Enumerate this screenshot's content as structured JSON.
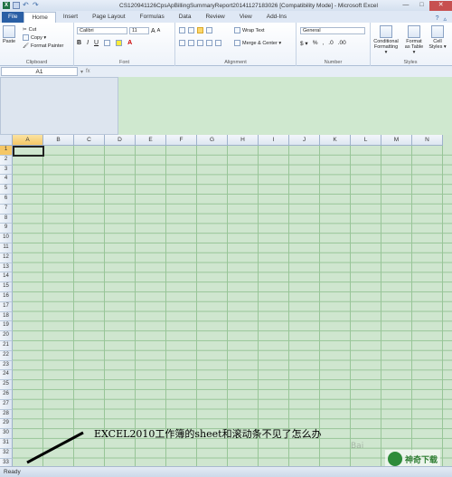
{
  "title_bar": {
    "title": "CS120941126CpsApBillingSummaryReport20141127183026  [Compatibility Mode]  -  Microsoft Excel",
    "minimize": "—",
    "maximize": "□",
    "close": "✕"
  },
  "tabs": [
    "File",
    "Home",
    "Insert",
    "Page Layout",
    "Formulas",
    "Data",
    "Review",
    "View",
    "Add-Ins"
  ],
  "ribbon": {
    "clipboard": {
      "paste": "Paste",
      "cut": "Cut",
      "copy": "Copy ▾",
      "format_painter": "Format Painter",
      "label": "Clipboard"
    },
    "font": {
      "font_name": "Calibri",
      "font_size": "11",
      "grow": "A",
      "shrink": "A",
      "bold": "B",
      "italic": "I",
      "underline": "U",
      "label": "Font"
    },
    "alignment": {
      "wrap_text": "Wrap Text",
      "merge_center": "Merge & Center ▾",
      "label": "Alignment"
    },
    "number": {
      "format": "General",
      "currency": "$ ▾",
      "percent": "%",
      "comma": ",",
      "label": "Number"
    },
    "styles": {
      "conditional": "Conditional Formatting ▾",
      "format_table": "Format as Table ▾",
      "cell_styles": "Cell Styles ▾",
      "label": "Styles"
    }
  },
  "formula_bar": {
    "name_box": "A1",
    "fx": "fx",
    "value": ""
  },
  "columns": [
    "A",
    "B",
    "C",
    "D",
    "E",
    "F",
    "G",
    "H",
    "I",
    "J",
    "K",
    "L",
    "M",
    "N"
  ],
  "rows": [
    "1",
    "2",
    "3",
    "4",
    "5",
    "6",
    "7",
    "8",
    "9",
    "10",
    "11",
    "12",
    "13",
    "14",
    "15",
    "16",
    "17",
    "18",
    "19",
    "20",
    "21",
    "22",
    "23",
    "24",
    "25",
    "26",
    "27",
    "28",
    "29",
    "30",
    "31",
    "32",
    "33"
  ],
  "status": {
    "text": "Ready"
  },
  "annotation": {
    "text": "EXCEL2010工作簿的sheet和滚动条不见了怎么办"
  },
  "watermark": {
    "text": "神奇下载",
    "faint": "Bai"
  },
  "colors": {
    "grid_background": "#cfe6cf",
    "file_tab": "#2a5fa5",
    "selected_header": "#f5c766"
  }
}
